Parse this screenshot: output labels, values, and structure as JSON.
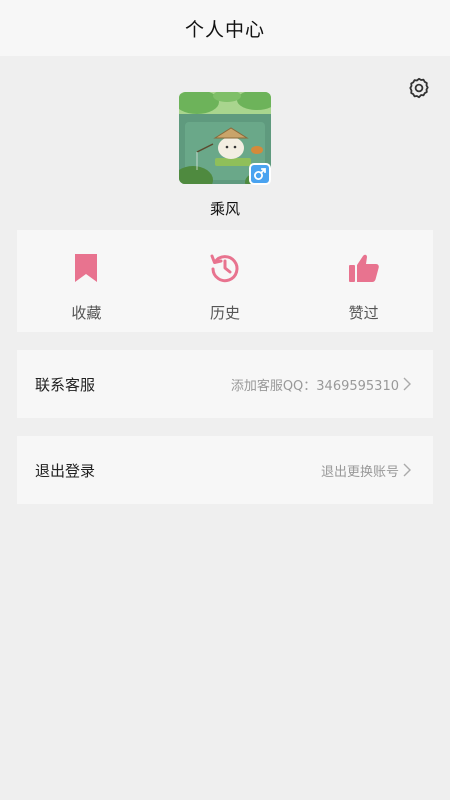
{
  "header": {
    "title": "个人中心"
  },
  "profile": {
    "nickname": "乘风",
    "gender_icon": "male-icon"
  },
  "quick_actions": [
    {
      "label": "收藏",
      "icon": "bookmark-icon",
      "color": "#e8738f"
    },
    {
      "label": "历史",
      "icon": "history-icon",
      "color": "#e8738f"
    },
    {
      "label": "赞过",
      "icon": "thumbs-up-icon",
      "color": "#e8738f"
    }
  ],
  "rows": {
    "contact": {
      "label": "联系客服",
      "value": "添加客服QQ：3469595310"
    },
    "logout": {
      "label": "退出登录",
      "value": "退出更换账号"
    }
  },
  "colors": {
    "accent": "#e8738f",
    "background": "#efefef",
    "card": "#f7f7f7",
    "gender_badge": "#4aa3f0"
  }
}
